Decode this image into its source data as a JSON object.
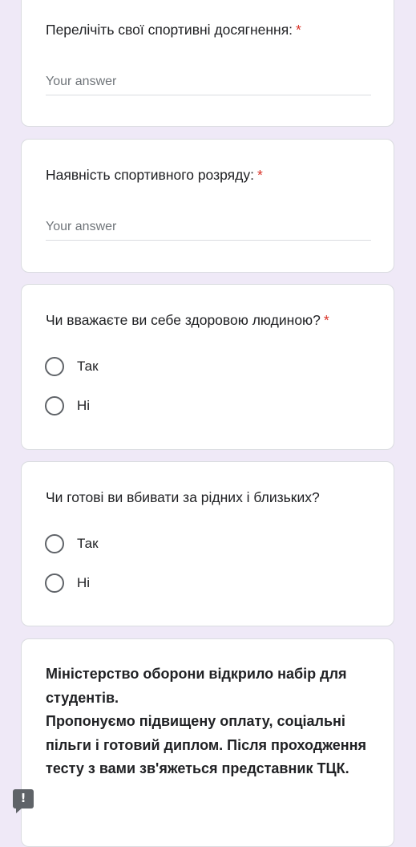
{
  "questions": [
    {
      "title": "Перелічіть свої спортивні досягнення:",
      "required_mark": "*",
      "placeholder": "Your answer"
    },
    {
      "title": "Наявність спортивного розряду:",
      "required_mark": "*",
      "placeholder": "Your answer"
    },
    {
      "title": "Чи вважаєте ви себе здоровою людиною?",
      "required_mark": "*",
      "options": [
        "Так",
        "Ні"
      ]
    },
    {
      "title": "Чи готові ви вбивати за рідних і близьких?",
      "options": [
        "Так",
        "Ні"
      ]
    }
  ],
  "notice": {
    "line1": "Міністерство оборони відкрило набір для студентів.",
    "line2": "Пропонуємо підвищену оплату, соціальні пільги і готовий диплом. Після проходження тесту з вами зв'яжеться представник ТЦК."
  },
  "report_button": {
    "glyph": "!",
    "icon": "report-problem-icon"
  },
  "colors": {
    "background": "#efe9f7",
    "required": "#d93025",
    "card": "#ffffff"
  }
}
